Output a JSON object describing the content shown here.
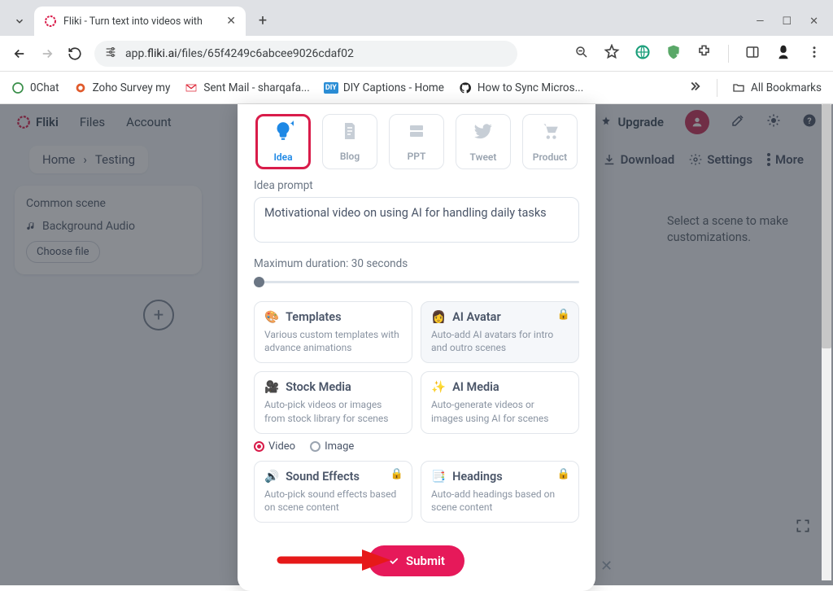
{
  "browser": {
    "tab_title": "Fliki - Turn text into videos with",
    "url_prefix": "app.",
    "url_domain": "fliki.ai",
    "url_path": "/files/65f4249c6abcee9026cdaf02",
    "bookmarks": [
      {
        "label": "0Chat"
      },
      {
        "label": "Zoho Survey my"
      },
      {
        "label": "Sent Mail - sharqafa..."
      },
      {
        "label": "DIY Captions - Home"
      },
      {
        "label": "How to Sync Micros..."
      }
    ],
    "all_bookmarks": "All Bookmarks"
  },
  "app": {
    "brand": "Fliki",
    "menu": [
      "Files",
      "Account"
    ],
    "upgrade": "Upgrade",
    "breadcrumb": [
      "Home",
      "Testing"
    ],
    "download": "Download",
    "settings": "Settings",
    "more": "More",
    "common_scene": "Common scene",
    "background_audio": "Background Audio",
    "choose_file": "Choose file",
    "right_msg": "Select a scene to make customizations."
  },
  "modal": {
    "types": [
      {
        "label": "Idea"
      },
      {
        "label": "Blog"
      },
      {
        "label": "PPT"
      },
      {
        "label": "Tweet"
      },
      {
        "label": "Product"
      }
    ],
    "active_type": 0,
    "prompt_label": "Idea prompt",
    "prompt_value": "Motivational video on using AI for handling daily tasks",
    "duration_label": "Maximum duration: 30 seconds",
    "options": {
      "templates": {
        "title": "Templates",
        "desc": "Various custom templates with advance animations"
      },
      "ai_avatar": {
        "title": "AI Avatar",
        "desc": "Auto-add AI avatars for intro and outro scenes",
        "locked": true
      },
      "stock_media": {
        "title": "Stock Media",
        "desc": "Auto-pick videos or images from stock library for scenes"
      },
      "ai_media": {
        "title": "AI Media",
        "desc": "Auto-generate videos or images using AI for scenes"
      },
      "sound_effects": {
        "title": "Sound Effects",
        "desc": "Auto-pick sound effects based on scene content",
        "locked": true
      },
      "headings": {
        "title": "Headings",
        "desc": "Auto-add headings based on scene content",
        "locked": true
      }
    },
    "radio_video": "Video",
    "radio_image": "Image",
    "submit": "Submit"
  }
}
